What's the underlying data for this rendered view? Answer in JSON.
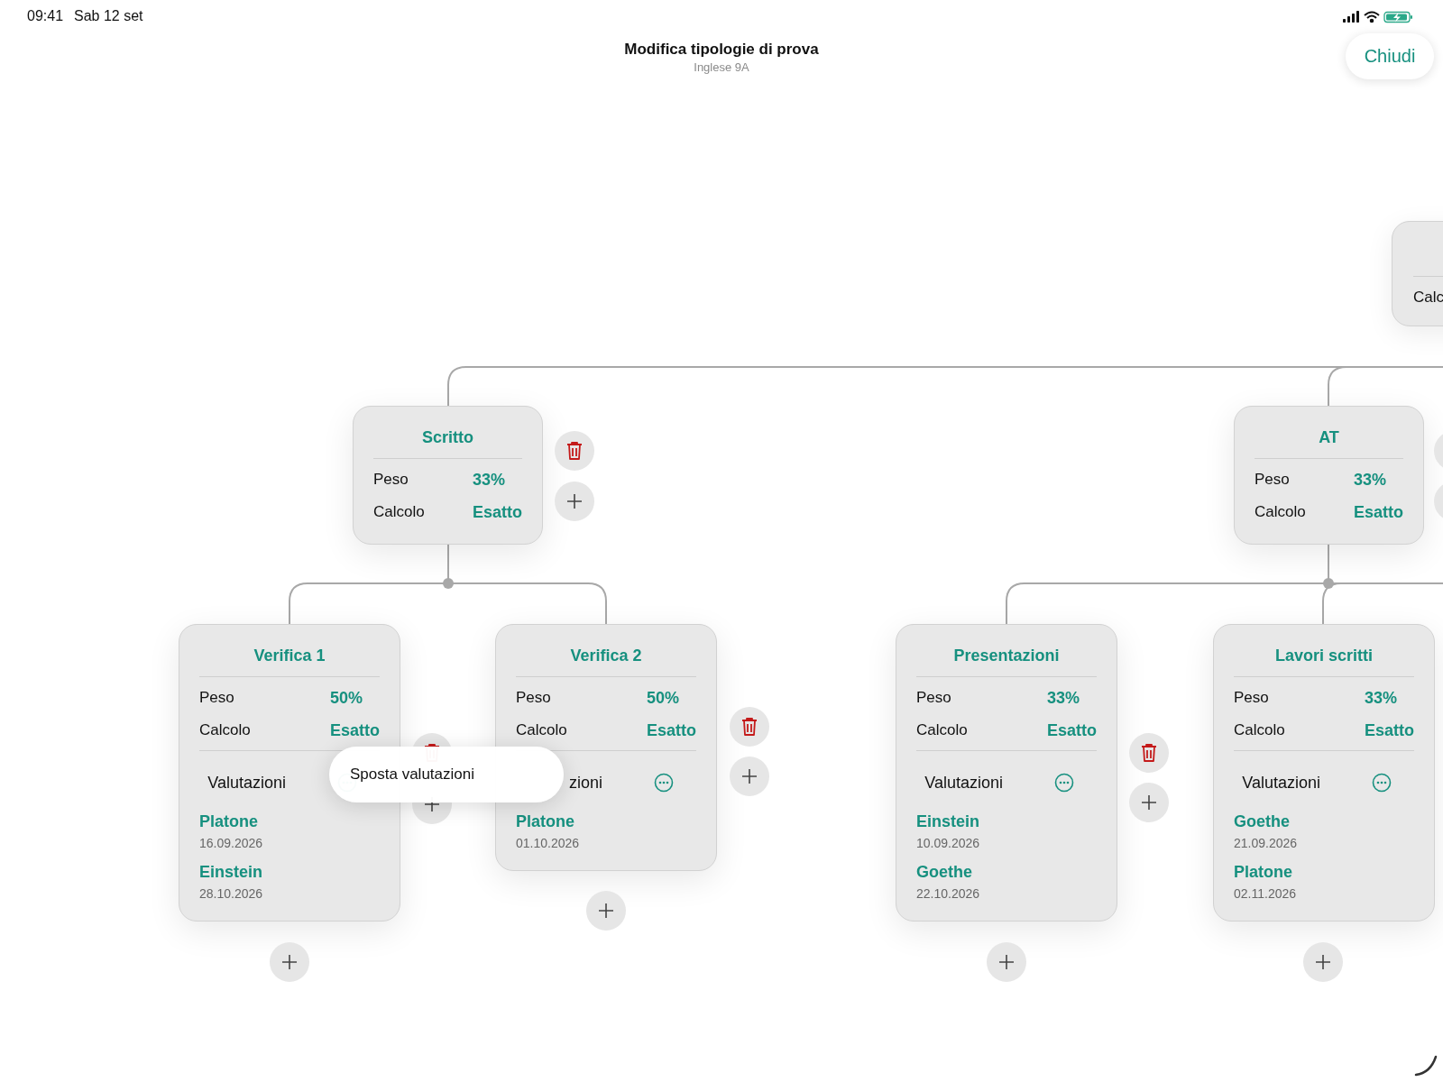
{
  "status_bar": {
    "time": "09:41",
    "date": "Sab 12 set"
  },
  "header": {
    "title": "Modifica tipologie di prova",
    "subtitle": "Inglese 9A"
  },
  "close_button": "Chiudi",
  "root_node": {
    "label": "Calc"
  },
  "categories": [
    {
      "title": "Scritto",
      "rows": [
        {
          "label": "Peso",
          "value": "33%"
        },
        {
          "label": "Calcolo",
          "value": "Esatto"
        }
      ],
      "children": [
        {
          "title": "Verifica 1",
          "rows": [
            {
              "label": "Peso",
              "value": "50%"
            },
            {
              "label": "Calcolo",
              "value": "Esatto"
            }
          ],
          "assessments": {
            "label": "Valutazioni",
            "entries": [
              {
                "name": "Platone",
                "date": "16.09.2026"
              },
              {
                "name": "Einstein",
                "date": "28.10.2026"
              }
            ]
          }
        },
        {
          "title": "Verifica 2",
          "rows": [
            {
              "label": "Peso",
              "value": "50%"
            },
            {
              "label": "Calcolo",
              "value": "Esatto"
            }
          ],
          "assessments": {
            "label": "zioni",
            "entries": [
              {
                "name": "Platone",
                "date": "01.10.2026"
              }
            ]
          }
        }
      ]
    },
    {
      "title": "AT",
      "rows": [
        {
          "label": "Peso",
          "value": "33%"
        },
        {
          "label": "Calcolo",
          "value": "Esatto"
        }
      ],
      "children": [
        {
          "title": "Presentazioni",
          "rows": [
            {
              "label": "Peso",
              "value": "33%"
            },
            {
              "label": "Calcolo",
              "value": "Esatto"
            }
          ],
          "assessments": {
            "label": "Valutazioni",
            "entries": [
              {
                "name": "Einstein",
                "date": "10.09.2026"
              },
              {
                "name": "Goethe",
                "date": "22.10.2026"
              }
            ]
          }
        },
        {
          "title": "Lavori scritti",
          "rows": [
            {
              "label": "Peso",
              "value": "33%"
            },
            {
              "label": "Calcolo",
              "value": "Esatto"
            }
          ],
          "assessments": {
            "label": "Valutazioni",
            "entries": [
              {
                "name": "Goethe",
                "date": "21.09.2026"
              },
              {
                "name": "Platone",
                "date": "02.11.2026"
              }
            ]
          }
        }
      ]
    }
  ],
  "context_menu": {
    "items": [
      "Sposta valutazioni"
    ]
  }
}
